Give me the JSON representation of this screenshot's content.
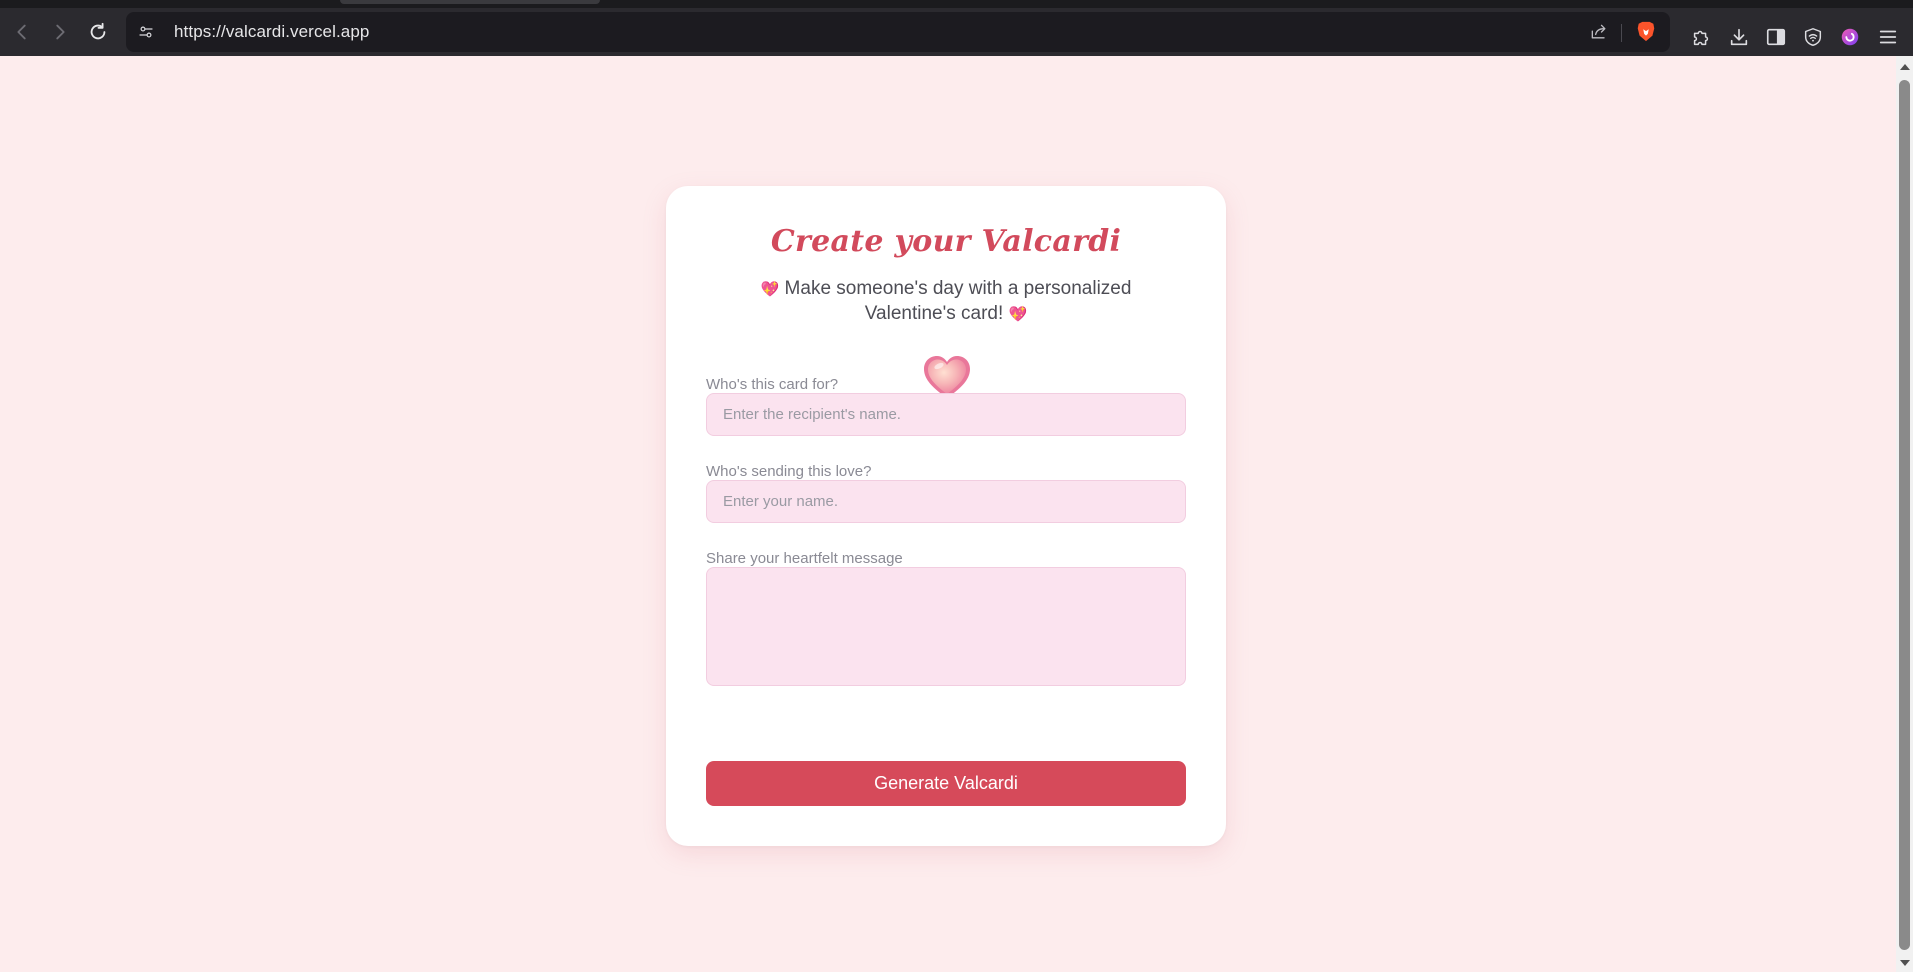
{
  "browser": {
    "url": "https://valcardi.vercel.app",
    "icons": {
      "back": "back-arrow-icon",
      "forward": "forward-arrow-icon",
      "reload": "reload-icon",
      "site_settings": "site-settings-icon",
      "share": "share-icon",
      "brave_shields": "brave-lion-icon",
      "extensions": "puzzle-icon",
      "downloads": "download-icon",
      "sidebar": "sidebar-icon",
      "vpn": "shield-wifi-icon",
      "leo": "leo-ai-icon",
      "menu": "hamburger-menu-icon"
    }
  },
  "card": {
    "title": "Create your Valcardi",
    "subtitle_text": "Make someone's day with a personalized Valentine's card!",
    "subtitle_emoji_left": "💖",
    "subtitle_emoji_right": "💖",
    "illustration": "heart-illustration",
    "fields": [
      {
        "label": "Who's this card for?",
        "placeholder": "Enter the recipient's name.",
        "value": ""
      },
      {
        "label": "Who's sending this love?",
        "placeholder": "Enter your name.",
        "value": ""
      },
      {
        "label": "Share your heartfelt message",
        "placeholder": "",
        "value": ""
      }
    ],
    "button_label": "Generate Valcardi"
  },
  "colors": {
    "page_background": "#fdeced",
    "accent": "#d64a5a",
    "input_background": "#fbe3ef",
    "title_color": "#d24a5c"
  }
}
